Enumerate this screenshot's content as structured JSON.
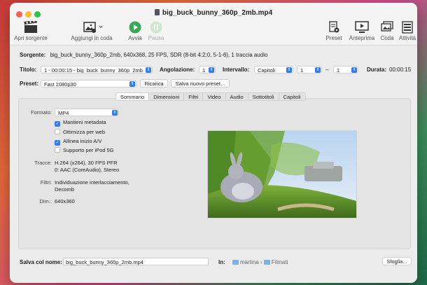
{
  "window": {
    "title": "big_buck_bunny_360p_2mb.mp4"
  },
  "toolbar": {
    "open_source": "Apri sorgente",
    "add_to_queue": "Aggiungi in coda",
    "start": "Avvia",
    "pause": "Pausa",
    "preset": "Preset",
    "preview": "Anteprima",
    "queue": "Coda",
    "activity": "Attività"
  },
  "source": {
    "label": "Sorgente:",
    "value": "big_buck_bunny_360p_2mb, 640x368, 25 FPS, SDR (8-bit 4:2:0, 5-1-6), 1 traccia audio"
  },
  "title_row": {
    "title_label": "Titolo:",
    "title_value": "1 - 00:00:15 - big_buck_bunny_360p_2mb",
    "angle_label": "Angolazione:",
    "angle_value": "1",
    "range_label": "Intervallo:",
    "range_type": "Capitoli",
    "range_from": "1",
    "range_sep": "–",
    "range_to": "1",
    "duration_label": "Durata:",
    "duration_value": "00:00:15"
  },
  "preset_row": {
    "label": "Preset:",
    "value": "Fast 1080p30",
    "reload": "Ricarica",
    "save_new": "Salva nuovo preset..."
  },
  "tabs": [
    "Sommario",
    "Dimensioni",
    "Filtri",
    "Video",
    "Audio",
    "Sottotitoli",
    "Capitoli"
  ],
  "summary": {
    "format_label": "Formato:",
    "format_value": "MP4",
    "options": [
      {
        "label": "Mantieni metadata",
        "checked": true
      },
      {
        "label": "Ottimizza per web",
        "checked": false
      },
      {
        "label": "Allinea inizio A/V",
        "checked": true
      },
      {
        "label": "Supporto per iPod 5G",
        "checked": false
      }
    ],
    "tracks_label": "Tracce:",
    "tracks_line1": "H.264 (x264), 30 FPS PFR",
    "tracks_line2": "0: AAC (CoreAudio), Stereo",
    "filters_label": "Filtri:",
    "filters_line1": "Individuazione interlacciamento,",
    "filters_line2": "Decomb",
    "dim_label": "Dim.:",
    "dim_value": "640x360"
  },
  "bottom": {
    "save_label": "Salva col nome:",
    "save_value": "big_buck_bunny_360p_2mb.mp4",
    "in_label": "In:",
    "path_user": "martina",
    "path_sep": "›",
    "path_folder": "Filmati",
    "browse": "Sfoglia..."
  },
  "colors": {
    "accent": "#2f7bf6",
    "start_green": "#3aa757"
  }
}
